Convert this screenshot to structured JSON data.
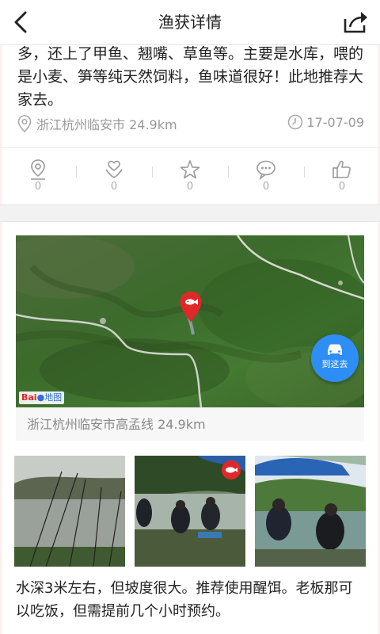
{
  "nav": {
    "title": "渔获详情"
  },
  "description": "多，还上了甲鱼、翘嘴、草鱼等。主要是水库，喂的是小麦、笋等纯天然饲料，鱼味道很好！此地推荐大家去。",
  "meta": {
    "location": "浙江杭州临安市 24.9km",
    "date": "17-07-09"
  },
  "actions": [
    {
      "icon": "location-pin-icon",
      "count": "0"
    },
    {
      "icon": "heart-hand-icon",
      "count": "0"
    },
    {
      "icon": "star-icon",
      "count": "0"
    },
    {
      "icon": "comment-icon",
      "count": "0"
    },
    {
      "icon": "thumbs-up-icon",
      "count": "0"
    }
  ],
  "map": {
    "navigate_label": "到这去",
    "brand_label": "Bai",
    "brand_label_2": "地图",
    "location_text": "浙江杭州临安市高孟线 24.9km"
  },
  "tip": "水深3米左右，但坡度很大。推荐使用醒饵。老板那可以吃饭，但需提前几个小时预约。",
  "colors": {
    "accent": "#2f8ef5",
    "pin": "#e0282a",
    "text": "#222222",
    "muted": "#999999"
  }
}
